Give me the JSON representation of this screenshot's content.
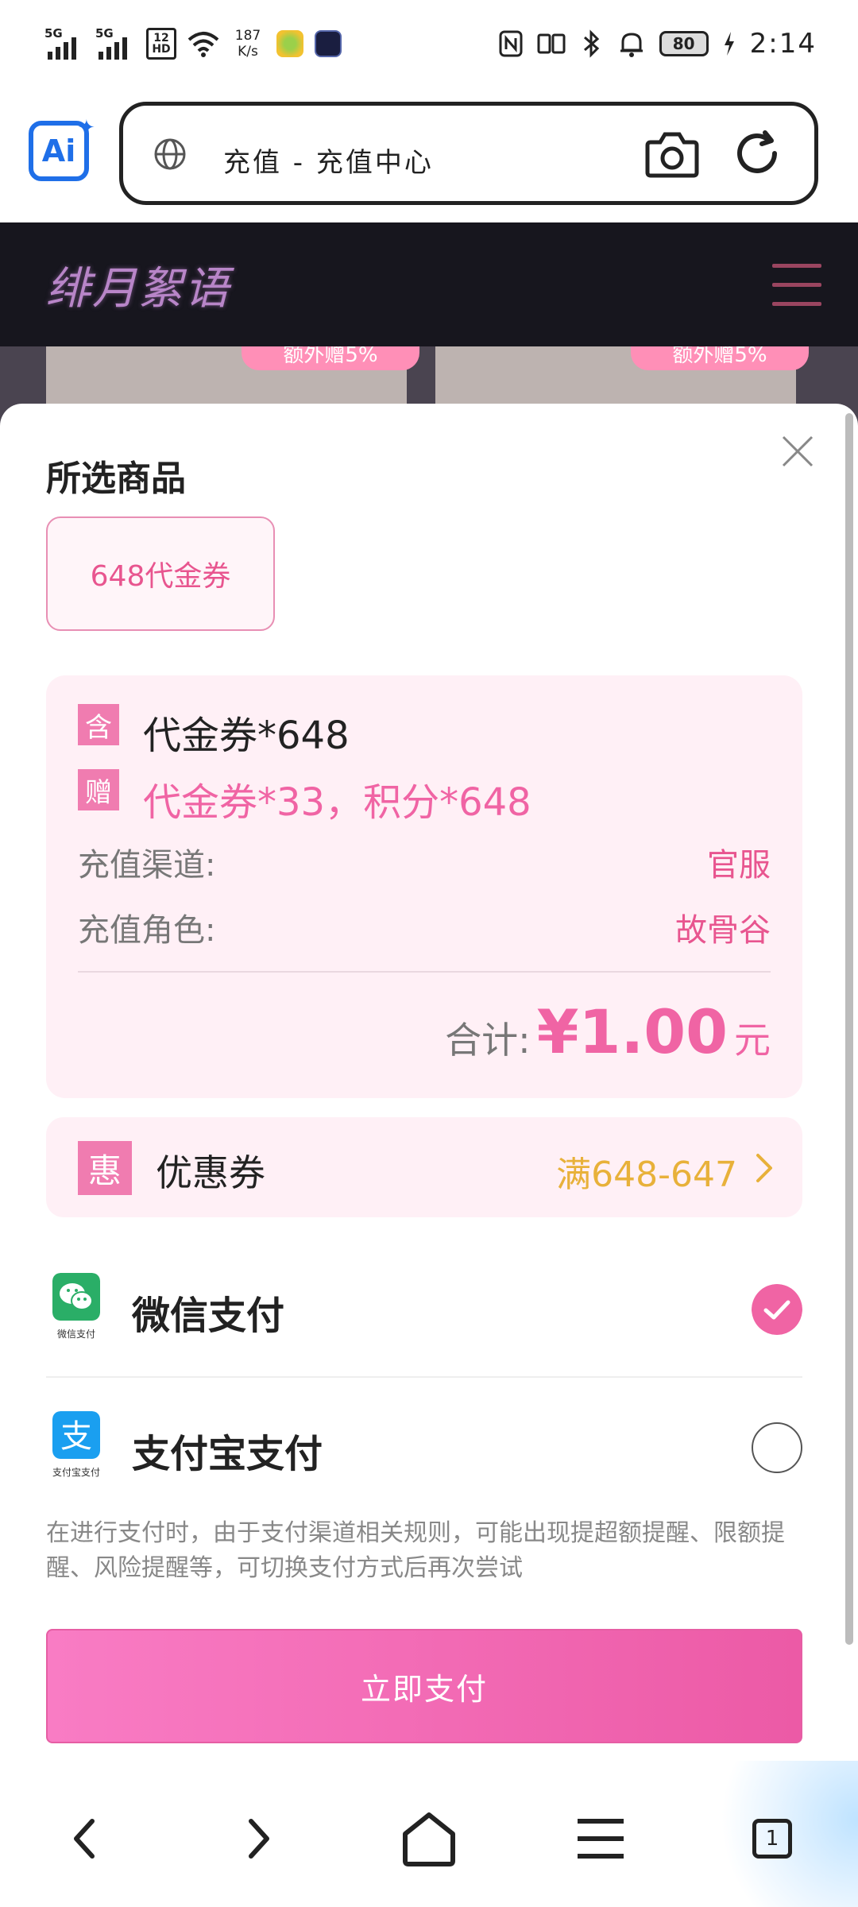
{
  "status_bar": {
    "signal1": "5G",
    "signal2": "5G",
    "hd_badge": "HD",
    "hd_number": "12",
    "net_speed_value": "187",
    "net_speed_unit": "K/s",
    "battery": "80",
    "time": "2:14",
    "icons": [
      "nfc-icon",
      "vibrate-icon",
      "bluetooth-icon",
      "bell-icon",
      "battery-icon",
      "charging-icon"
    ]
  },
  "browser": {
    "ai_label": "Ai",
    "tab_title": "充值 - 充值中心",
    "tab_count": "1",
    "accent_color": "#1f6fe8"
  },
  "site": {
    "logo_text": "绯月絮语",
    "peek_badge_left": "额外赠5%",
    "peek_badge_right": "额外赠5%"
  },
  "sheet": {
    "section_title": "所选商品",
    "selected_product": "648代金券",
    "included_tag": "含",
    "included_text": "代金券*648",
    "gift_tag": "赠",
    "gift_text": "代金券*33，积分*648",
    "channel_label": "充值渠道:",
    "channel_value": "官服",
    "role_label": "充值角色:",
    "role_value": "故骨谷",
    "total_label": "合计:",
    "total_amount": "¥1.00",
    "total_unit": "元",
    "coupon_tag": "惠",
    "coupon_label": "优惠券",
    "coupon_value": "满648-647",
    "payment_methods": [
      {
        "label": "微信支付",
        "icon_caption": "微信支付",
        "selected": true
      },
      {
        "label": "支付宝支付",
        "icon_caption": "支付宝支付",
        "selected": false
      }
    ],
    "notice": "在进行支付时，由于支付渠道相关规则，可能出现提超额提醒、限额提醒、风险提醒等，可切换支付方式后再次尝试",
    "pay_button": "立即支付",
    "brand_pink": "#f064a4"
  }
}
